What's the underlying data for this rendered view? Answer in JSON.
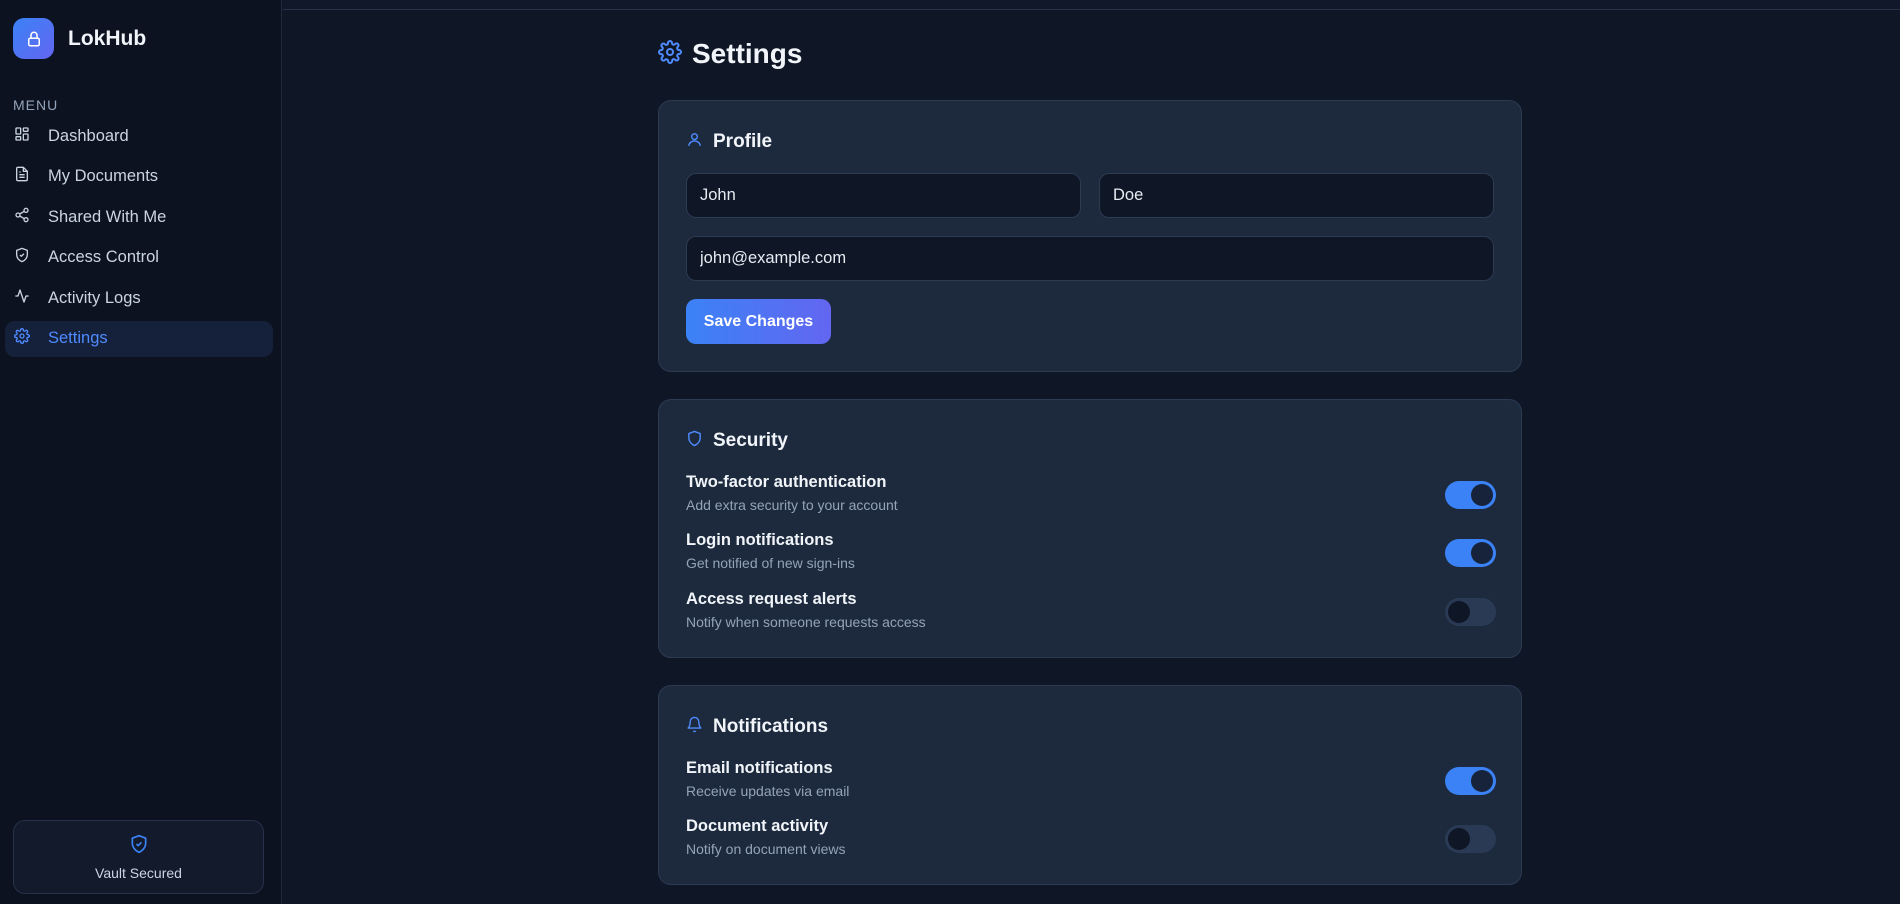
{
  "brand": {
    "name": "LokHub"
  },
  "sidebar": {
    "menu_label": "MENU",
    "items": [
      {
        "label": "Dashboard",
        "icon": "dashboard-icon",
        "active": false
      },
      {
        "label": "My Documents",
        "icon": "document-icon",
        "active": false
      },
      {
        "label": "Shared With Me",
        "icon": "share-icon",
        "active": false
      },
      {
        "label": "Access Control",
        "icon": "shield-check-icon",
        "active": false
      },
      {
        "label": "Activity Logs",
        "icon": "activity-icon",
        "active": false
      },
      {
        "label": "Settings",
        "icon": "gear-icon",
        "active": true
      }
    ],
    "vault_label": "Vault Secured"
  },
  "page": {
    "title": "Settings"
  },
  "profile": {
    "title": "Profile",
    "first_name": "John",
    "last_name": "Doe",
    "email": "john@example.com",
    "save_label": "Save Changes"
  },
  "security": {
    "title": "Security",
    "items": [
      {
        "title": "Two-factor authentication",
        "desc": "Add extra security to your account",
        "on": true
      },
      {
        "title": "Login notifications",
        "desc": "Get notified of new sign-ins",
        "on": true
      },
      {
        "title": "Access request alerts",
        "desc": "Notify when someone requests access",
        "on": false
      }
    ]
  },
  "notifications": {
    "title": "Notifications",
    "items": [
      {
        "title": "Email notifications",
        "desc": "Receive updates via email",
        "on": true
      },
      {
        "title": "Document activity",
        "desc": "Notify on document views",
        "on": false
      }
    ]
  },
  "colors": {
    "accent": "#3b82f6",
    "accent_2": "#6366f1",
    "background": "#0f1626",
    "card": "#1d2a3e"
  }
}
